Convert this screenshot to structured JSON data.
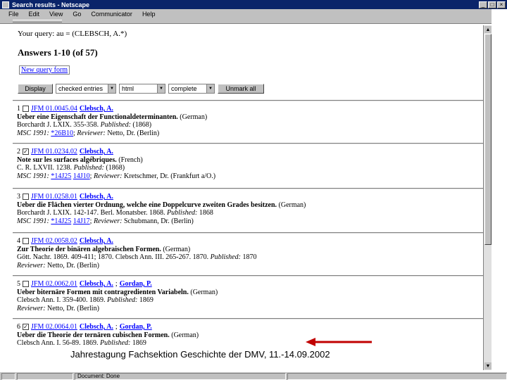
{
  "window": {
    "title": "Search results - Netscape"
  },
  "window_buttons": [
    "_",
    "□",
    "×"
  ],
  "menu": [
    "File",
    "Edit",
    "View",
    "Go",
    "Communicator",
    "Help"
  ],
  "query": {
    "label": "Your query:",
    "value": "au = (CLEBSCH, A.*)"
  },
  "answers": {
    "text": "Answers 1-10 (of 57)"
  },
  "new_query": {
    "label": "New query form"
  },
  "controls": {
    "display_label": "Display",
    "entries_select": "checked entries",
    "format_select": "html",
    "mode_select": "complete",
    "unmark_label": "Unmark all"
  },
  "results": [
    {
      "num": "1",
      "checked": false,
      "id": "JFM 01.0045.04",
      "authors": [
        "Clebsch, A."
      ],
      "title": "Ueber eine Eigenschaft der Functionaldeterminanten.",
      "lang": "(German)",
      "source": "Borchardt J. LXIX. 355-358.",
      "published_label": "Published:",
      "published": "(1868)",
      "msc_label": "MSC 1991:",
      "msc": [
        "*26B10"
      ],
      "reviewer_label": "Reviewer:",
      "reviewer": "Netto, Dr. (Berlin)"
    },
    {
      "num": "2",
      "checked": true,
      "id": "JFM 01.0234.02",
      "authors": [
        "Clebsch, A."
      ],
      "title": "Note sur les surfaces algébriques.",
      "lang": "(French)",
      "source": "C. R. LXVII. 1238.",
      "published_label": "Published:",
      "published": "(1868)",
      "msc_label": "MSC 1991:",
      "msc": [
        "*14J25",
        "14J10"
      ],
      "reviewer_label": "Reviewer:",
      "reviewer": "Kretschmer, Dr. (Frankfurt a/O.)"
    },
    {
      "num": "3",
      "checked": false,
      "id": "JFM 01.0258.01",
      "authors": [
        "Clebsch, A."
      ],
      "title": "Ueber die Flächen vierter Ordnung, welche eine Doppelcurve zweiten Grades besitzen.",
      "lang": "(German)",
      "source": "Borchardt J. LXIX. 142-147. Berl. Monatsber. 1868.",
      "published_label": "Published:",
      "published": "1868",
      "msc_label": "MSC 1991:",
      "msc": [
        "*14J25",
        "14J17"
      ],
      "reviewer_label": "Reviewer:",
      "reviewer": "Schubmann, Dr. (Berlin)"
    },
    {
      "num": "4",
      "checked": false,
      "id": "JFM 02.0058.02",
      "authors": [
        "Clebsch, A."
      ],
      "title": "Zur Theorie der binären algebraischen Formen.",
      "lang": "(German)",
      "source": "Gött. Nachr. 1869. 409-411; 1870. Clebsch Ann. III. 265-267. 1870.",
      "published_label": "Published:",
      "published": "1870",
      "msc_label": "",
      "msc": [],
      "reviewer_label": "Reviewer:",
      "reviewer": "Netto, Dr. (Berlin)"
    },
    {
      "num": "5",
      "checked": false,
      "id": "JFM 02.0062.01",
      "authors": [
        "Clebsch, A.",
        "Gordan, P."
      ],
      "title": "Ueber biternäre Formen mit contragredienten Variabeln.",
      "lang": "(German)",
      "source": "Clebsch Ann. I. 359-400. 1869.",
      "published_label": "Published:",
      "published": "1869",
      "msc_label": "",
      "msc": [],
      "reviewer_label": "Reviewer:",
      "reviewer": "Netto, Dr. (Berlin)"
    },
    {
      "num": "6",
      "checked": true,
      "id": "JFM 02.0064.01",
      "authors": [
        "Clebsch, A.",
        "Gordan, P."
      ],
      "title": "Ueber die Theorie der ternären cubischen Formen.",
      "lang": "(German)",
      "source": "Clebsch Ann. I. 56-89. 1869.",
      "published_label": "Published:",
      "published": "1869",
      "msc_label": "",
      "msc": [],
      "reviewer_label": "",
      "reviewer": ""
    }
  ],
  "caption": "Jahrestagung Fachsektion Geschichte der DMV, 11.-14.09.2002",
  "status": {
    "text": "Document: Done"
  },
  "colors": {
    "title_bar": "#0a246a",
    "link": "#0000ff",
    "chrome": "#c0c0c0",
    "annotation_arrow": "#c00000"
  }
}
